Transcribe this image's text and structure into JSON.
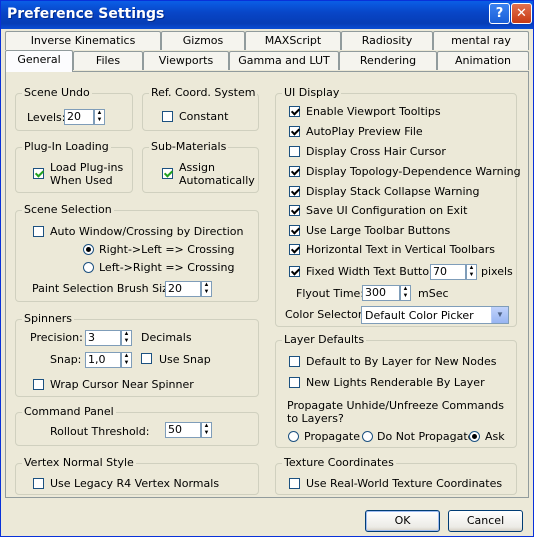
{
  "window": {
    "title": "Preference Settings",
    "help_glyph": "?",
    "close_glyph": "✕"
  },
  "tabs_row1": [
    "Inverse Kinematics",
    "Gizmos",
    "MAXScript",
    "Radiosity",
    "mental ray"
  ],
  "tabs_row2": [
    "General",
    "Files",
    "Viewports",
    "Gamma and LUT",
    "Rendering",
    "Animation"
  ],
  "active_tab": "General",
  "scene_undo": {
    "title": "Scene Undo",
    "levels_label": "Levels:",
    "levels_value": "20"
  },
  "ref_coord": {
    "title": "Ref. Coord. System",
    "constant_label": "Constant",
    "constant_checked": false
  },
  "plugin_loading": {
    "title": "Plug-In Loading",
    "load_label_1": "Load Plug-ins",
    "load_label_2": "When Used",
    "load_checked": true
  },
  "sub_materials": {
    "title": "Sub-Materials",
    "assign_label_1": "Assign",
    "assign_label_2": "Automatically",
    "assign_checked": true
  },
  "scene_selection": {
    "title": "Scene Selection",
    "auto_window_label": "Auto Window/Crossing by Direction",
    "auto_window_checked": false,
    "radio_rl_label": "Right->Left => Crossing",
    "radio_lr_label": "Left->Right => Crossing",
    "selected": "Right->Left => Crossing",
    "brush_label": "Paint Selection Brush Size",
    "brush_value": "20"
  },
  "spinners": {
    "title": "Spinners",
    "precision_label": "Precision:",
    "precision_value": "3",
    "decimals_label": "Decimals",
    "snap_label": "Snap:",
    "snap_value": "1,0",
    "use_snap_label": "Use Snap",
    "use_snap_checked": false,
    "wrap_label": "Wrap Cursor Near Spinner",
    "wrap_checked": false
  },
  "command_panel": {
    "title": "Command Panel",
    "rollout_label": "Rollout Threshold:",
    "rollout_value": "50"
  },
  "vertex_normal": {
    "title": "Vertex Normal Style",
    "legacy_label": "Use Legacy R4 Vertex Normals",
    "legacy_checked": false
  },
  "ui_display": {
    "title": "UI Display",
    "items": [
      {
        "label": "Enable Viewport Tooltips",
        "checked": true
      },
      {
        "label": "AutoPlay Preview File",
        "checked": true
      },
      {
        "label": "Display Cross Hair Cursor",
        "checked": false
      },
      {
        "label": "Display Topology-Dependence Warning",
        "checked": true
      },
      {
        "label": "Display Stack Collapse Warning",
        "checked": true
      },
      {
        "label": "Save UI Configuration on Exit",
        "checked": true
      },
      {
        "label": "Use Large Toolbar Buttons",
        "checked": true
      },
      {
        "label": "Horizontal Text in Vertical Toolbars",
        "checked": true
      },
      {
        "label": "Fixed Width Text Buttons:",
        "checked": true
      }
    ],
    "fixed_width_value": "70",
    "pixels_label": "pixels",
    "flyout_label": "Flyout Time:",
    "flyout_value": "300",
    "msec_label": "mSec",
    "color_selector_label": "Color Selector:",
    "color_selector_value": "Default Color Picker"
  },
  "layer_defaults": {
    "title": "Layer Defaults",
    "default_bylayer_label": "Default to By Layer for New Nodes",
    "default_bylayer_checked": false,
    "new_lights_label": "New Lights Renderable By Layer",
    "new_lights_checked": false,
    "propagate_q1": "Propagate Unhide/Unfreeze Commands",
    "propagate_q2": "to Layers?",
    "radio_propagate": "Propagate",
    "radio_no_propagate": "Do Not Propagate",
    "radio_ask": "Ask",
    "selected": "Ask"
  },
  "texture_coords": {
    "title": "Texture Coordinates",
    "realworld_label": "Use Real-World Texture Coordinates",
    "realworld_checked": false
  },
  "buttons": {
    "ok": "OK",
    "cancel": "Cancel"
  },
  "icons": {
    "spinner_up": "▲",
    "spinner_down": "▼",
    "dropdown": "▼"
  }
}
